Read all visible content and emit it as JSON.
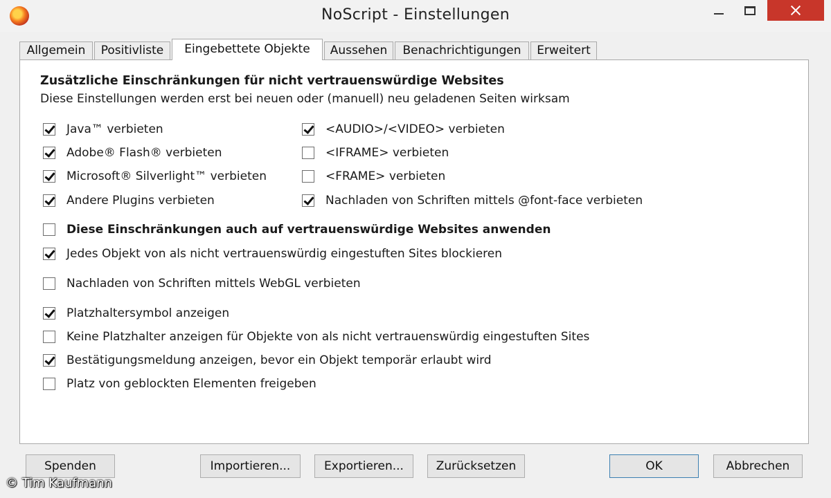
{
  "window": {
    "title": "NoScript - Einstellungen"
  },
  "tabs": [
    {
      "label": "Allgemein"
    },
    {
      "label": "Positivliste"
    },
    {
      "label": "Eingebettete Objekte",
      "selected": true
    },
    {
      "label": "Aussehen"
    },
    {
      "label": "Benachrichtigungen"
    },
    {
      "label": "Erweitert"
    }
  ],
  "panel": {
    "heading": "Zusätzliche Einschränkungen für nicht vertrauenswürdige Websites",
    "subline": "Diese Einstellungen werden erst bei neuen oder (manuell) neu geladenen Seiten wirksam",
    "left_options": [
      {
        "label": "Java™ verbieten",
        "checked": true
      },
      {
        "label": "Adobe® Flash® verbieten",
        "checked": true
      },
      {
        "label": "Microsoft® Silverlight™ verbieten",
        "checked": true
      },
      {
        "label": "Andere Plugins verbieten",
        "checked": true
      }
    ],
    "right_options": [
      {
        "label": "<AUDIO>/<VIDEO> verbieten",
        "checked": true
      },
      {
        "label": "<IFRAME> verbieten",
        "checked": false
      },
      {
        "label": "<FRAME> verbieten",
        "checked": false
      },
      {
        "label": "Nachladen von Schriften mittels @font-face verbieten",
        "checked": true
      }
    ],
    "options": [
      {
        "label": "Diese Einschränkungen auch auf vertrauenswürdige Websites anwenden",
        "checked": false,
        "bold": true
      },
      {
        "label": "Jedes Objekt von als nicht vertrauenswürdig eingestuften Sites blockieren",
        "checked": true
      },
      {
        "label": "Nachladen von Schriften mittels WebGL verbieten",
        "checked": false
      },
      {
        "label": "Platzhaltersymbol anzeigen",
        "checked": true
      },
      {
        "label": "Keine Platzhalter anzeigen für Objekte von als nicht vertrauenswürdig eingestuften Sites",
        "checked": false
      },
      {
        "label": "Bestätigungsmeldung anzeigen, bevor ein Objekt temporär erlaubt wird",
        "checked": true
      },
      {
        "label": "Platz von geblockten Elementen freigeben",
        "checked": false
      }
    ]
  },
  "buttons": {
    "spenden": "Spenden",
    "importieren": "Importieren...",
    "exportieren": "Exportieren...",
    "zuruecksetzen": "Zurücksetzen",
    "ok": "OK",
    "abbrechen": "Abbrechen"
  },
  "credit": "© Tim Kaufmann"
}
